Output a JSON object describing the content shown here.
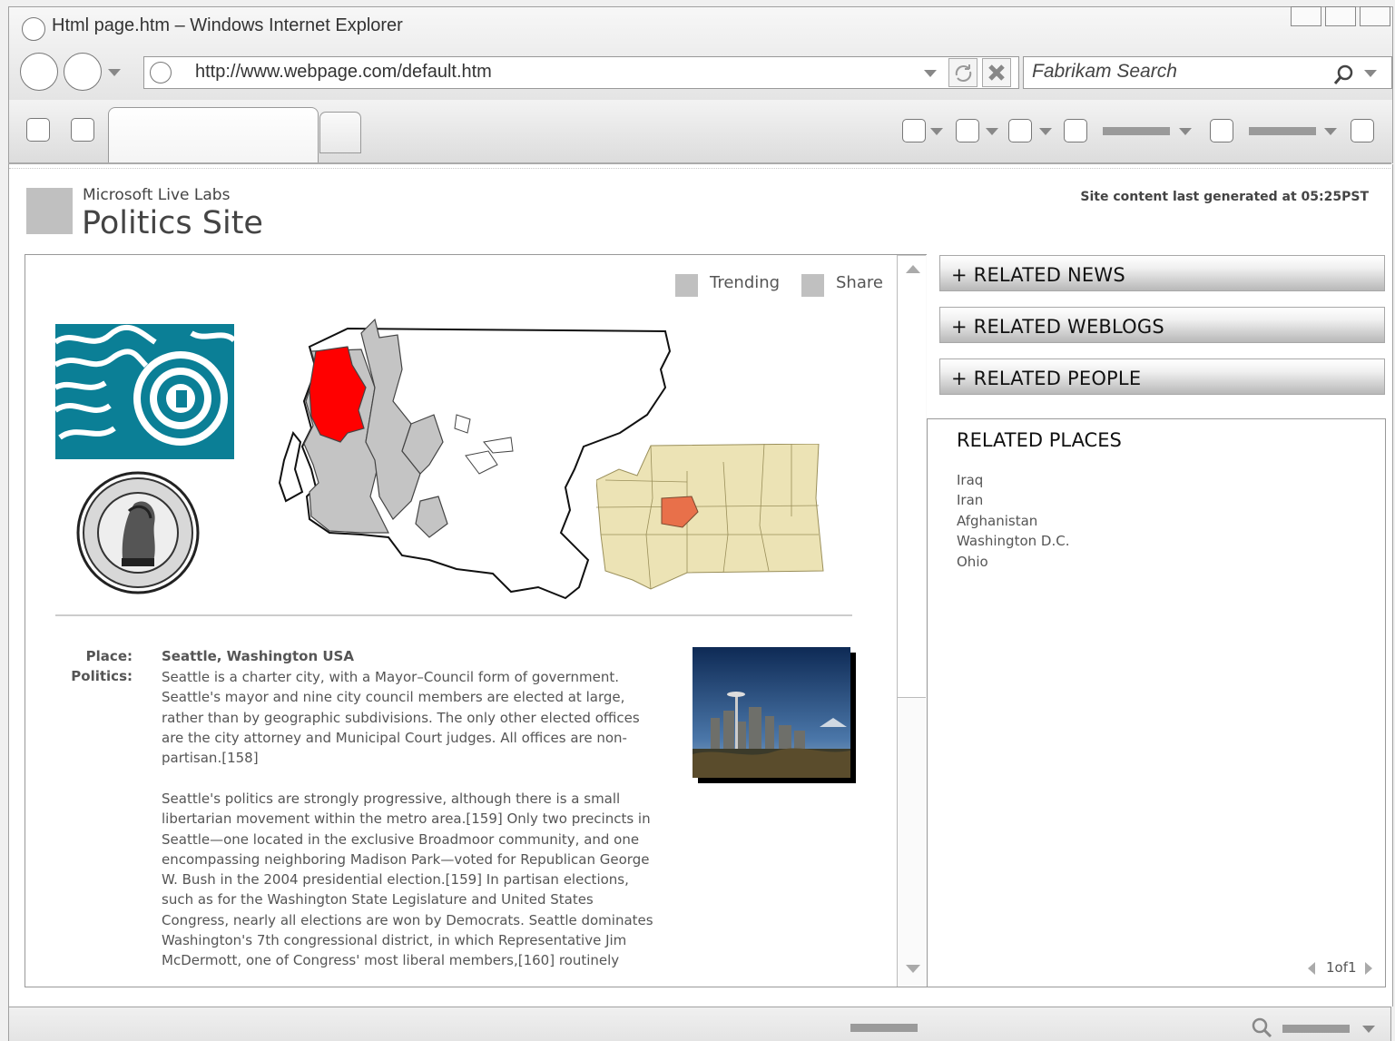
{
  "browser": {
    "window_title": "Html page.htm – Windows Internet Explorer",
    "address": "http://www.webpage.com/default.htm",
    "search_placeholder": "Fabrikam Search"
  },
  "site": {
    "org": "Microsoft Live Labs",
    "title": "Politics Site",
    "generated": "Site content last generated at 05:25PST"
  },
  "actions": {
    "trending": "Trending",
    "share": "Share"
  },
  "article": {
    "place_label": "Place:",
    "place_value": "Seattle, Washington USA",
    "politics_label": "Politics:",
    "paragraph1": "Seattle is a charter city, with a Mayor–Council form of government. Seattle's mayor and nine city council members are elected at large, rather than by geographic subdivisions. The only other elected offices are the city attorney and Municipal Court judges. All offices are non-partisan.[158]",
    "paragraph2": "Seattle's politics are strongly progressive, although there is a small libertarian movement within the metro area.[159] Only two precincts in Seattle—one located in the exclusive Broadmoor community, and one encompassing neighboring Madison Park—voted for Republican George W. Bush in the 2004 presidential election.[159] In partisan elections, such as for the Washington State Legislature and United States Congress, nearly all elections are won by Democrats. Seattle dominates Washington's 7th congressional district, in which Representative Jim McDermott, one of Congress' most liberal members,[160] routinely"
  },
  "sidebar": {
    "panels": [
      "+ RELATED NEWS",
      "+ RELATED WEBLOGS",
      "+ RELATED PEOPLE"
    ],
    "places_heading": "RELATED PLACES",
    "places": [
      "Iraq",
      "Iran",
      "Afghanistan",
      "Washington D.C.",
      "Ohio"
    ],
    "pager": "1of1"
  },
  "colors": {
    "flag_teal": "#0b7f96",
    "highlight_red": "#ff0000",
    "county_orange": "#e8704a",
    "state_tan": "#ece3b5"
  }
}
